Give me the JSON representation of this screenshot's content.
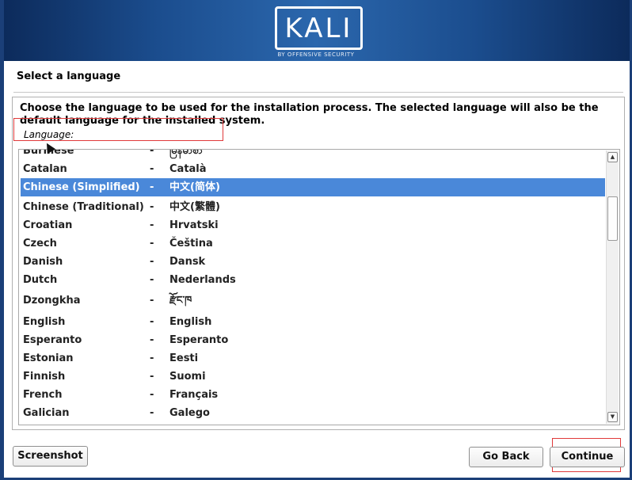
{
  "banner": {
    "logo_text": "KALI",
    "logo_subtitle": "BY OFFENSIVE SECURITY"
  },
  "step": {
    "title": "Select a language"
  },
  "panel": {
    "description": "Choose the language to be used for the installation process. The selected language will also be the default language for the installed system.",
    "list_label": "Language:"
  },
  "languages": [
    {
      "name": "Burmese",
      "separator": "-",
      "native": "မြန်မာစာ"
    },
    {
      "name": "Catalan",
      "separator": "-",
      "native": "Català"
    },
    {
      "name": "Chinese (Simplified)",
      "separator": "-",
      "native": "中文(简体)",
      "selected": true
    },
    {
      "name": "Chinese (Traditional)",
      "separator": "-",
      "native": "中文(繁體)"
    },
    {
      "name": "Croatian",
      "separator": "-",
      "native": "Hrvatski"
    },
    {
      "name": "Czech",
      "separator": "-",
      "native": "Čeština"
    },
    {
      "name": "Danish",
      "separator": "-",
      "native": "Dansk"
    },
    {
      "name": "Dutch",
      "separator": "-",
      "native": "Nederlands"
    },
    {
      "name": "Dzongkha",
      "separator": "-",
      "native": "རྫོང་ཁ"
    },
    {
      "name": "English",
      "separator": "-",
      "native": "English"
    },
    {
      "name": "Esperanto",
      "separator": "-",
      "native": "Esperanto"
    },
    {
      "name": "Estonian",
      "separator": "-",
      "native": "Eesti"
    },
    {
      "name": "Finnish",
      "separator": "-",
      "native": "Suomi"
    },
    {
      "name": "French",
      "separator": "-",
      "native": "Français"
    },
    {
      "name": "Galician",
      "separator": "-",
      "native": "Galego"
    }
  ],
  "scrollbar": {
    "up_icon": "arrow-up-icon",
    "down_icon": "arrow-down-icon"
  },
  "buttons": {
    "screenshot": "Screenshot",
    "go_back": "Go Back",
    "continue": "Continue"
  },
  "colors": {
    "selection": "#4a88d9",
    "highlight_box": "#e0393a",
    "banner": "#1b4d8e"
  }
}
